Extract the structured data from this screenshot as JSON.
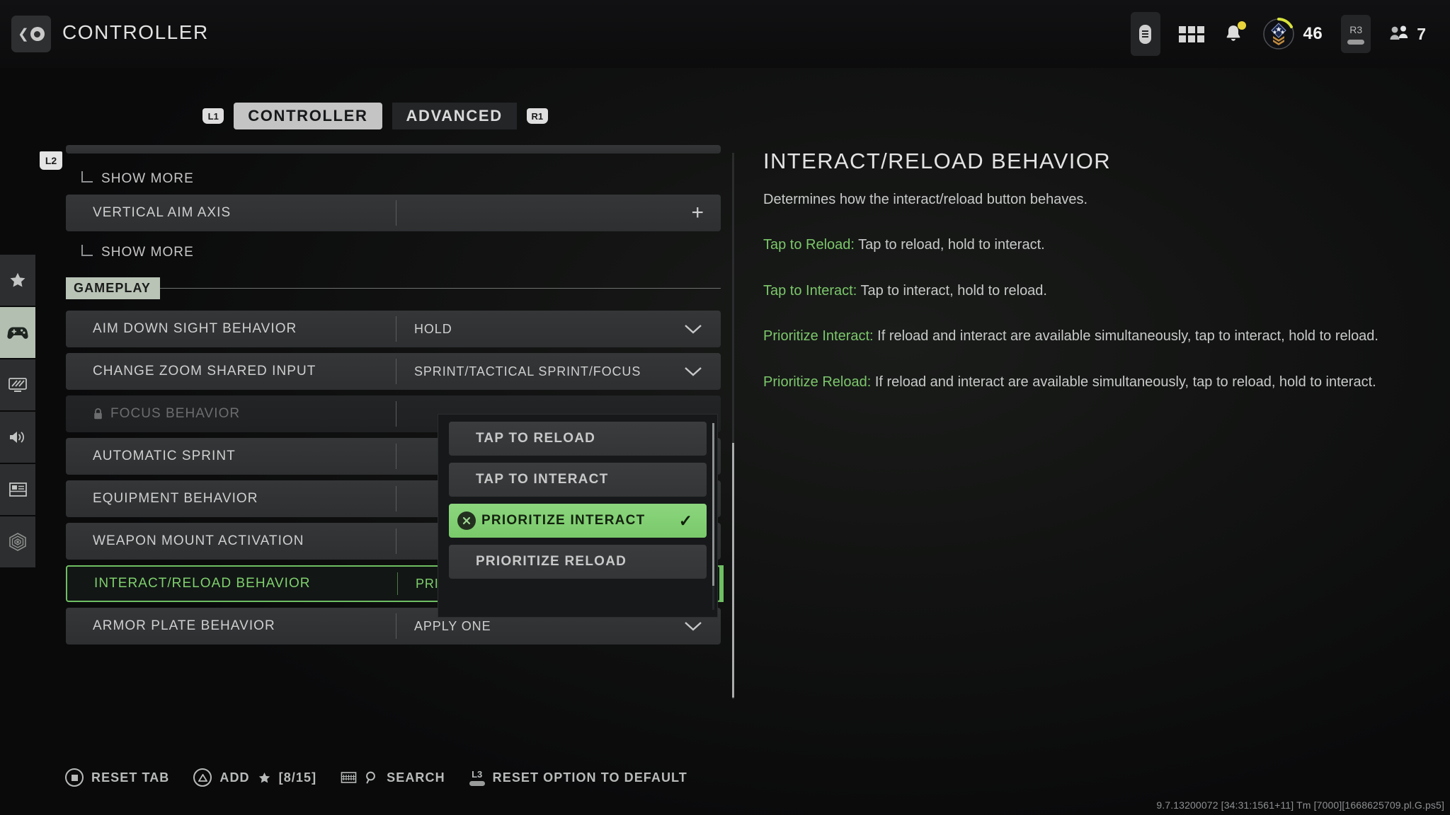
{
  "header": {
    "title": "CONTROLLER",
    "back_icon": "back-circle-icon",
    "hud": {
      "touchpad_icon": "touchpad-icon",
      "apps_icon": "grid-apps-icon",
      "notifications_icon": "bell-icon",
      "rank_icon": "rank-badge-icon",
      "rank_level": "46",
      "r3_label": "R3",
      "party_icon": "party-icon",
      "party_count": "7"
    }
  },
  "tabs": {
    "left_bumper": "L1",
    "right_bumper": "R1",
    "items": [
      {
        "label": "CONTROLLER",
        "active": true
      },
      {
        "label": "ADVANCED",
        "active": false
      }
    ]
  },
  "rail": {
    "l2_badge": "L2",
    "items": [
      {
        "name": "favorites",
        "icon": "star-icon",
        "active": false
      },
      {
        "name": "controller",
        "icon": "gamepad-icon",
        "active": true
      },
      {
        "name": "graphics",
        "icon": "monitor-icon",
        "active": false
      },
      {
        "name": "audio",
        "icon": "speaker-icon",
        "active": false
      },
      {
        "name": "interface",
        "icon": "layout-icon",
        "active": false
      },
      {
        "name": "account-network",
        "icon": "signal-hex-icon",
        "active": false
      }
    ]
  },
  "settings": {
    "top_clipped_row": "",
    "pre_rows": [
      {
        "type": "sub",
        "label": "SHOW MORE",
        "icon": "elbow-icon"
      },
      {
        "type": "row",
        "label": "VERTICAL AIM AXIS",
        "value": "",
        "control": "plus-icon"
      },
      {
        "type": "sub",
        "label": "SHOW MORE",
        "icon": "elbow-icon"
      }
    ],
    "section_label": "GAMEPLAY",
    "rows": [
      {
        "label": "AIM DOWN SIGHT BEHAVIOR",
        "value": "HOLD",
        "chevron": "chevron-down-icon",
        "state": "normal"
      },
      {
        "label": "CHANGE ZOOM SHARED INPUT",
        "value": "SPRINT/TACTICAL SPRINT/FOCUS",
        "chevron": "chevron-down-icon",
        "state": "normal"
      },
      {
        "label": "FOCUS BEHAVIOR",
        "value": "",
        "chevron": "",
        "state": "disabled",
        "lock": "lock-icon"
      },
      {
        "label": "AUTOMATIC SPRINT",
        "value": "",
        "chevron": "",
        "state": "normal"
      },
      {
        "label": "EQUIPMENT BEHAVIOR",
        "value": "",
        "chevron": "",
        "state": "normal"
      },
      {
        "label": "WEAPON MOUNT ACTIVATION",
        "value": "",
        "chevron": "",
        "state": "normal"
      },
      {
        "label": "INTERACT/RELOAD BEHAVIOR",
        "value": "PRIORITIZE INTERACT",
        "chevron": "chevron-up-icon",
        "state": "selected"
      },
      {
        "label": "ARMOR PLATE BEHAVIOR",
        "value": "APPLY ONE",
        "chevron": "chevron-down-icon",
        "state": "normal"
      }
    ]
  },
  "dropdown": {
    "confirm_button_icon": "cross-button-icon",
    "check_icon": "check-icon",
    "options": [
      {
        "label": "TAP TO RELOAD",
        "selected": false
      },
      {
        "label": "TAP TO INTERACT",
        "selected": false
      },
      {
        "label": "PRIORITIZE INTERACT",
        "selected": true
      },
      {
        "label": "PRIORITIZE RELOAD",
        "selected": false
      }
    ]
  },
  "info": {
    "title": "INTERACT/RELOAD BEHAVIOR",
    "summary": "Determines how the interact/reload button behaves.",
    "entries": [
      {
        "term": "Tap to Reload:",
        "desc": " Tap to reload, hold to interact."
      },
      {
        "term": "Tap to Interact:",
        "desc": " Tap to interact, hold to reload."
      },
      {
        "term": "Prioritize Interact:",
        "desc": " If reload and interact are available simultaneously, tap to interact, hold to reload."
      },
      {
        "term": "Prioritize Reload:",
        "desc": " If reload and interact are available simultaneously, tap to reload, hold to interact."
      }
    ]
  },
  "footer": {
    "actions": [
      {
        "label": "RESET TAB",
        "icon": "ps-square-button-icon"
      },
      {
        "label": "ADD",
        "icon": "ps-triangle-button-icon",
        "star": "star-icon",
        "count": "[8/15]"
      },
      {
        "label": "SEARCH",
        "icon": "keyboard-icon",
        "secondary_icon": "magnifier-icon"
      },
      {
        "label": "RESET OPTION TO DEFAULT",
        "icon": "l3-stick-icon"
      }
    ],
    "build_string": "9.7.13200072 [34:31:1561+11] Tm [7000][1668625709.pl.G.ps5]"
  },
  "colors": {
    "accent_green": "#7fd06d",
    "dropdown_selected": "#82d073",
    "chip_bg": "#b9c4b7",
    "notification_dot": "#e8d43a"
  }
}
